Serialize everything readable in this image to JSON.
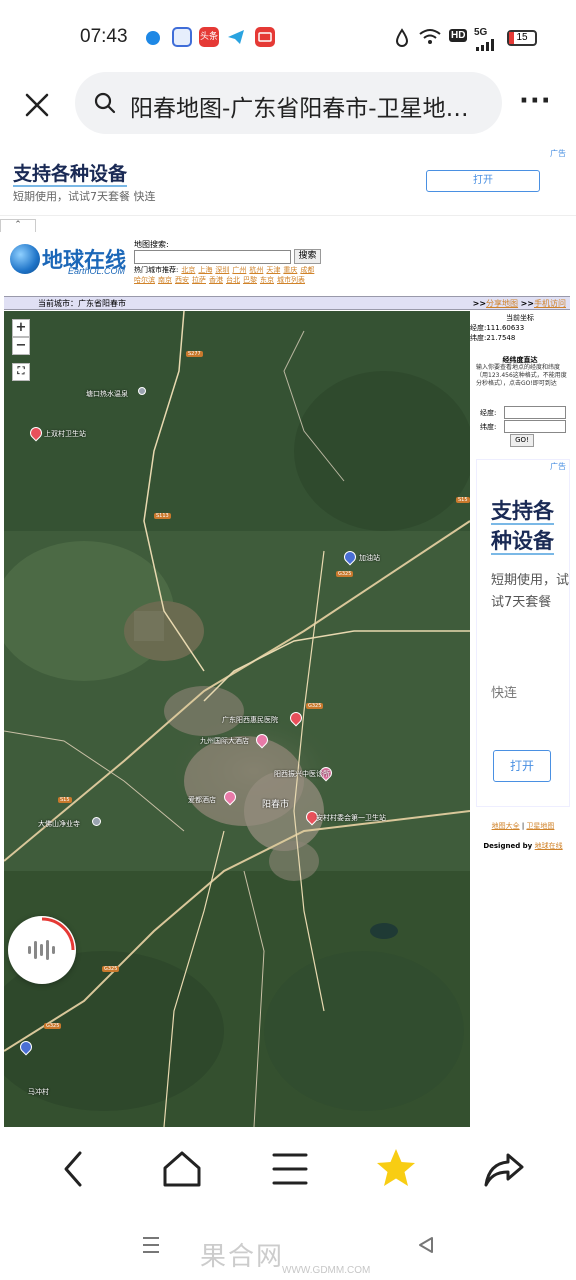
{
  "status": {
    "time": "07:43",
    "badge_toutiao": "头条",
    "signal": "5G",
    "battery": "15",
    "hd": "HD"
  },
  "browser": {
    "url_title": "阳春地图-广东省阳春市-卫星地图…",
    "more": "···"
  },
  "ad_top": {
    "tag": "广告",
    "title": "支持各种设备",
    "subtitle": "短期使用，试试7天套餐 快连",
    "button": "打开"
  },
  "site": {
    "logo_cn": "地球在线",
    "logo_en": "EarthOL.COM",
    "search_label": "地图搜索:",
    "search_button": "搜索",
    "hot_label": "热门城市推荐:",
    "hot_cities": [
      "北京",
      "上海",
      "深圳",
      "广州",
      "杭州",
      "天津",
      "重庆",
      "成都",
      "哈尔滨",
      "南京",
      "西安",
      "拉萨",
      "香港",
      "台北",
      "巴黎",
      "东京",
      "城市列表"
    ],
    "current_city_label": "当前城市：广东省阳春市",
    "share_prefix": ">>",
    "share_link": "分享地图",
    "mobile_prefix": ">>",
    "mobile_link": "手机访问"
  },
  "map": {
    "zoom_in": "+",
    "zoom_out": "−",
    "fullscreen": "⛶",
    "pois": [
      {
        "name": "塘口热水温泉"
      },
      {
        "name": "上双村卫生站"
      },
      {
        "name": "加油站"
      },
      {
        "name": "广东阳西惠民医院"
      },
      {
        "name": "九州国际大酒店"
      },
      {
        "name": "阳西振兴中医诊所"
      },
      {
        "name": "爱都酒店"
      },
      {
        "name": "阳春市"
      },
      {
        "name": "安村村委会第一卫生站"
      },
      {
        "name": "大佛山净业寺"
      },
      {
        "name": "马冲村"
      }
    ],
    "roads": [
      "S113",
      "G325",
      "S277",
      "S15"
    ]
  },
  "side": {
    "coord_title": "当前坐标",
    "lng": "经度:111.60633",
    "lat": "纬度:21.7548",
    "ll_title": "经纬度直达",
    "ll_desc": "输入你要查看地点的经度和纬度（用123.456这种格式，不能用度分秒格式），点击GO!即可到达",
    "lng_label": "经度:",
    "lat_label": "纬度:",
    "go": "GO!",
    "ad_tag": "广告",
    "ad_title": "支持各种设备",
    "ad_sub": "短期使用，试试7天套餐",
    "ad_sub2": "快连",
    "ad_button": "打开",
    "foot_link1": "地图大全",
    "foot_sep": " | ",
    "foot_link2": "卫星地图",
    "designed_by": "Designed by ",
    "designed_link": "地球在线"
  },
  "watermark": {
    "main": "果合网",
    "sub": "WWW.GDMM.COM"
  }
}
